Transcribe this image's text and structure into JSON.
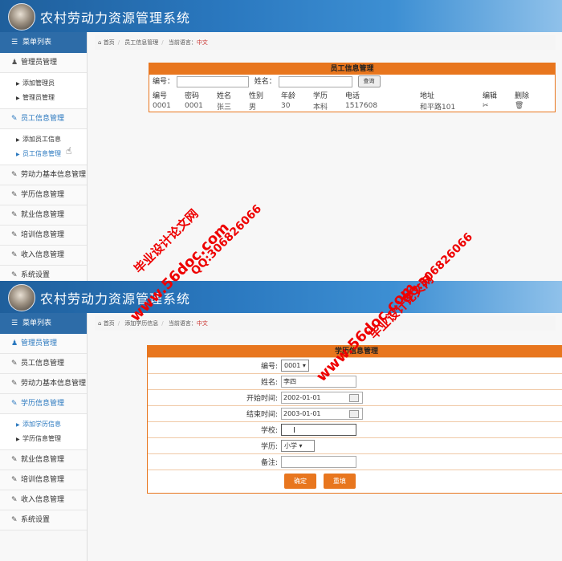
{
  "app": {
    "title": "农村劳动力资源管理系统"
  },
  "sidebar": {
    "header": "菜单列表",
    "admin_group": "管理员管理",
    "admin_items": [
      "添加管理员",
      "管理员管理"
    ],
    "employee_group": "员工信息管理",
    "employee_items": [
      "添加员工信息",
      "员工信息管理"
    ],
    "labor_group": "劳动力基本信息管理",
    "education_group": "学历信息管理",
    "education_items": [
      "添加学历信息",
      "学历信息管理"
    ],
    "job_group": "就业信息管理",
    "training_group": "培训信息管理",
    "income_group": "收入信息管理",
    "settings_group": "系统设置"
  },
  "breadcrumb1": {
    "home": "首页",
    "page": "员工信息管理",
    "lang_label": "当前语言：",
    "lang": "中文"
  },
  "breadcrumb2": {
    "home": "首页",
    "page": "添加学历信息",
    "lang_label": "当前语言：",
    "lang": "中文"
  },
  "employee_panel": {
    "title": "员工信息管理",
    "search_id_label": "编号：",
    "search_name_label": "姓名：",
    "search_button": "查询",
    "columns": [
      "编号",
      "密码",
      "姓名",
      "性别",
      "年龄",
      "学历",
      "电话",
      "地址",
      "编辑",
      "删除"
    ],
    "rows": [
      [
        "0001",
        "0001",
        "张三",
        "男",
        "30",
        "本科",
        "1517608",
        "和平路101"
      ]
    ]
  },
  "education_form": {
    "title": "学历信息管理",
    "id_label": "编号:",
    "id_value": "0001",
    "name_label": "姓名:",
    "name_value": "李四",
    "start_label": "开始时间:",
    "start_value": "2002-01-01",
    "end_label": "结束时间:",
    "end_value": "2003-01-01",
    "school_label": "学校:",
    "school_value": "",
    "degree_label": "学历:",
    "degree_value": "小学",
    "note_label": "备注:",
    "note_value": "",
    "submit": "确定",
    "reset": "重填"
  },
  "watermarks": {
    "site": "www.56doc.com",
    "qq": "QQ:306826066",
    "brand": "毕业设计论文网"
  },
  "colors": {
    "header": "#2a78bf",
    "accent": "#e8761e",
    "watermark": "#e00000"
  }
}
